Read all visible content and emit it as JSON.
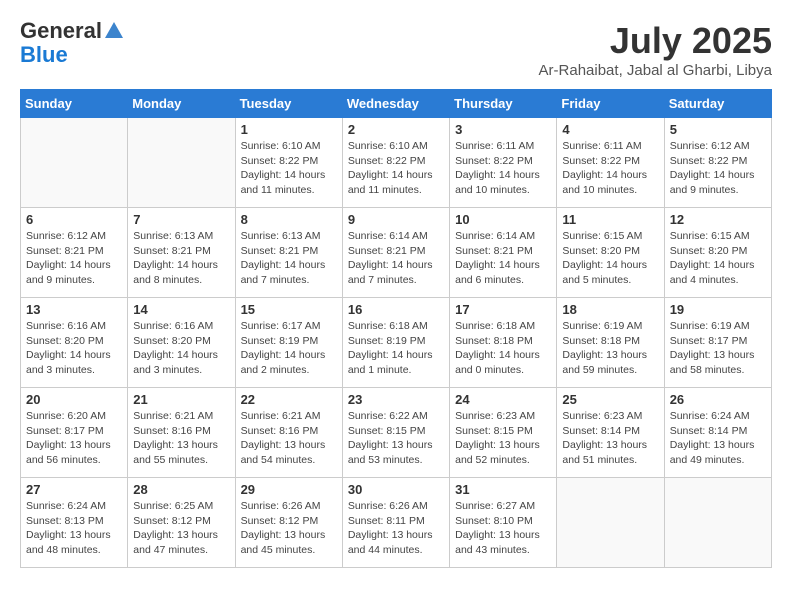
{
  "header": {
    "logo_general": "General",
    "logo_blue": "Blue",
    "title": "July 2025",
    "subtitle": "Ar-Rahaibat, Jabal al Gharbi, Libya"
  },
  "weekdays": [
    "Sunday",
    "Monday",
    "Tuesday",
    "Wednesday",
    "Thursday",
    "Friday",
    "Saturday"
  ],
  "weeks": [
    [
      {
        "day": null
      },
      {
        "day": null
      },
      {
        "day": "1",
        "sunrise": "6:10 AM",
        "sunset": "8:22 PM",
        "daylight": "14 hours and 11 minutes."
      },
      {
        "day": "2",
        "sunrise": "6:10 AM",
        "sunset": "8:22 PM",
        "daylight": "14 hours and 11 minutes."
      },
      {
        "day": "3",
        "sunrise": "6:11 AM",
        "sunset": "8:22 PM",
        "daylight": "14 hours and 10 minutes."
      },
      {
        "day": "4",
        "sunrise": "6:11 AM",
        "sunset": "8:22 PM",
        "daylight": "14 hours and 10 minutes."
      },
      {
        "day": "5",
        "sunrise": "6:12 AM",
        "sunset": "8:22 PM",
        "daylight": "14 hours and 9 minutes."
      }
    ],
    [
      {
        "day": "6",
        "sunrise": "6:12 AM",
        "sunset": "8:21 PM",
        "daylight": "14 hours and 9 minutes."
      },
      {
        "day": "7",
        "sunrise": "6:13 AM",
        "sunset": "8:21 PM",
        "daylight": "14 hours and 8 minutes."
      },
      {
        "day": "8",
        "sunrise": "6:13 AM",
        "sunset": "8:21 PM",
        "daylight": "14 hours and 7 minutes."
      },
      {
        "day": "9",
        "sunrise": "6:14 AM",
        "sunset": "8:21 PM",
        "daylight": "14 hours and 7 minutes."
      },
      {
        "day": "10",
        "sunrise": "6:14 AM",
        "sunset": "8:21 PM",
        "daylight": "14 hours and 6 minutes."
      },
      {
        "day": "11",
        "sunrise": "6:15 AM",
        "sunset": "8:20 PM",
        "daylight": "14 hours and 5 minutes."
      },
      {
        "day": "12",
        "sunrise": "6:15 AM",
        "sunset": "8:20 PM",
        "daylight": "14 hours and 4 minutes."
      }
    ],
    [
      {
        "day": "13",
        "sunrise": "6:16 AM",
        "sunset": "8:20 PM",
        "daylight": "14 hours and 3 minutes."
      },
      {
        "day": "14",
        "sunrise": "6:16 AM",
        "sunset": "8:20 PM",
        "daylight": "14 hours and 3 minutes."
      },
      {
        "day": "15",
        "sunrise": "6:17 AM",
        "sunset": "8:19 PM",
        "daylight": "14 hours and 2 minutes."
      },
      {
        "day": "16",
        "sunrise": "6:18 AM",
        "sunset": "8:19 PM",
        "daylight": "14 hours and 1 minute."
      },
      {
        "day": "17",
        "sunrise": "6:18 AM",
        "sunset": "8:18 PM",
        "daylight": "14 hours and 0 minutes."
      },
      {
        "day": "18",
        "sunrise": "6:19 AM",
        "sunset": "8:18 PM",
        "daylight": "13 hours and 59 minutes."
      },
      {
        "day": "19",
        "sunrise": "6:19 AM",
        "sunset": "8:17 PM",
        "daylight": "13 hours and 58 minutes."
      }
    ],
    [
      {
        "day": "20",
        "sunrise": "6:20 AM",
        "sunset": "8:17 PM",
        "daylight": "13 hours and 56 minutes."
      },
      {
        "day": "21",
        "sunrise": "6:21 AM",
        "sunset": "8:16 PM",
        "daylight": "13 hours and 55 minutes."
      },
      {
        "day": "22",
        "sunrise": "6:21 AM",
        "sunset": "8:16 PM",
        "daylight": "13 hours and 54 minutes."
      },
      {
        "day": "23",
        "sunrise": "6:22 AM",
        "sunset": "8:15 PM",
        "daylight": "13 hours and 53 minutes."
      },
      {
        "day": "24",
        "sunrise": "6:23 AM",
        "sunset": "8:15 PM",
        "daylight": "13 hours and 52 minutes."
      },
      {
        "day": "25",
        "sunrise": "6:23 AM",
        "sunset": "8:14 PM",
        "daylight": "13 hours and 51 minutes."
      },
      {
        "day": "26",
        "sunrise": "6:24 AM",
        "sunset": "8:14 PM",
        "daylight": "13 hours and 49 minutes."
      }
    ],
    [
      {
        "day": "27",
        "sunrise": "6:24 AM",
        "sunset": "8:13 PM",
        "daylight": "13 hours and 48 minutes."
      },
      {
        "day": "28",
        "sunrise": "6:25 AM",
        "sunset": "8:12 PM",
        "daylight": "13 hours and 47 minutes."
      },
      {
        "day": "29",
        "sunrise": "6:26 AM",
        "sunset": "8:12 PM",
        "daylight": "13 hours and 45 minutes."
      },
      {
        "day": "30",
        "sunrise": "6:26 AM",
        "sunset": "8:11 PM",
        "daylight": "13 hours and 44 minutes."
      },
      {
        "day": "31",
        "sunrise": "6:27 AM",
        "sunset": "8:10 PM",
        "daylight": "13 hours and 43 minutes."
      },
      {
        "day": null
      },
      {
        "day": null
      }
    ]
  ],
  "labels": {
    "sunrise_prefix": "Sunrise: ",
    "sunset_prefix": "Sunset: ",
    "daylight_prefix": "Daylight: "
  }
}
